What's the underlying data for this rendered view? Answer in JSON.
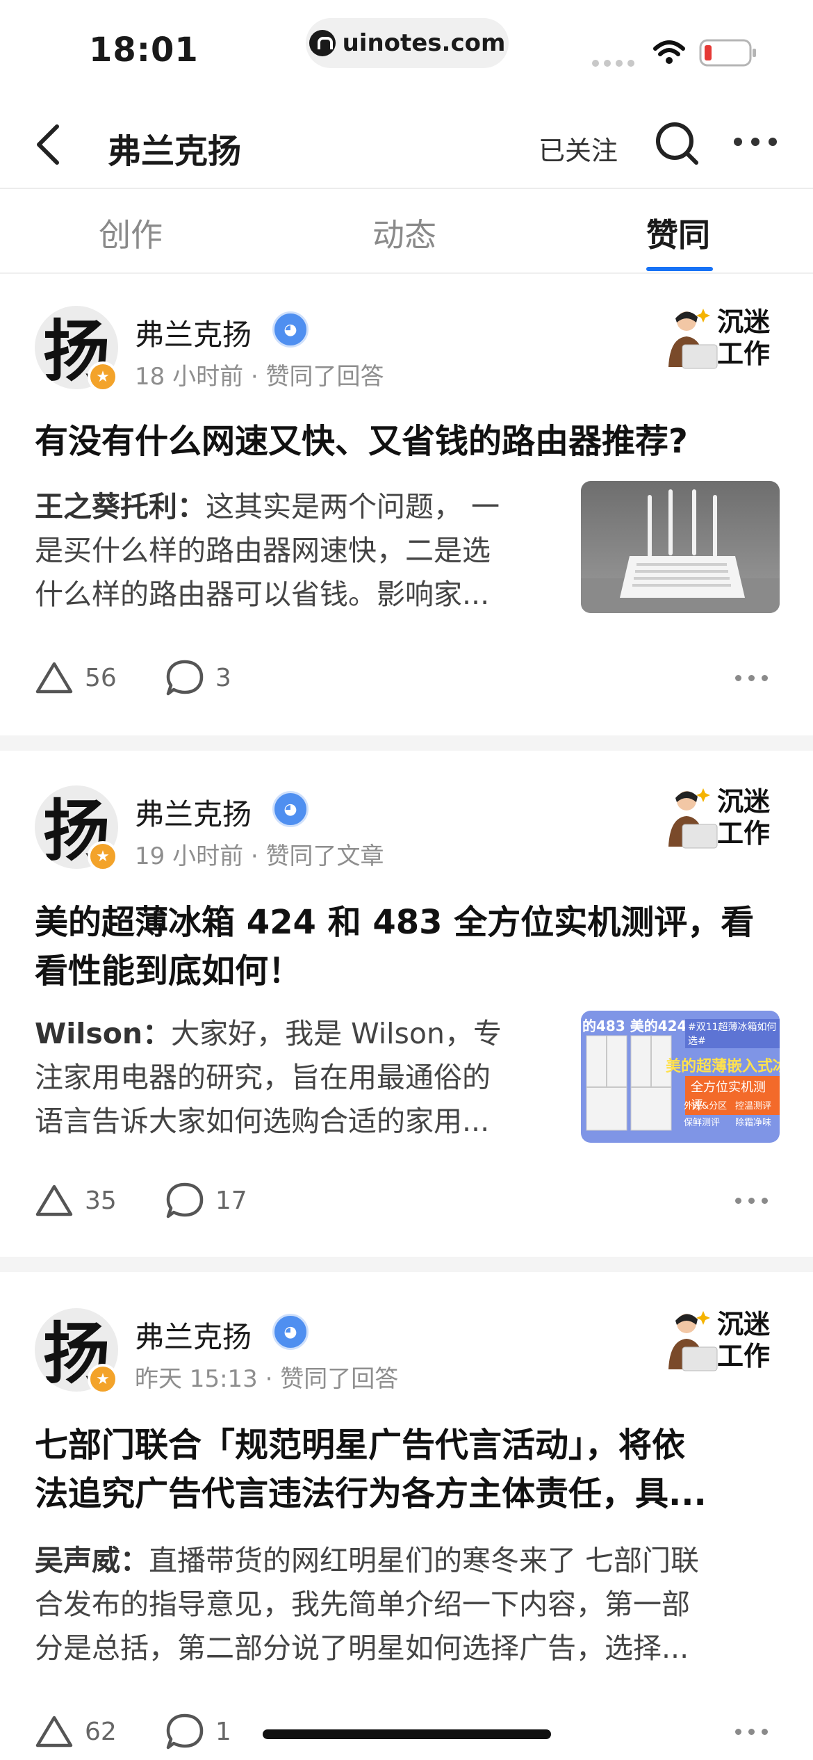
{
  "status_bar": {
    "time": "18:01",
    "url": "uinotes.com"
  },
  "header": {
    "title": "弗兰克扬",
    "follow_label": "已关注"
  },
  "tabs": [
    {
      "label": "创作",
      "active": false
    },
    {
      "label": "动态",
      "active": false
    },
    {
      "label": "赞同",
      "active": true
    }
  ],
  "feed": [
    {
      "avatar_char": "扬",
      "author": "弗兰克扬",
      "time": "18 小时前",
      "action": "赞同了回答",
      "promo_line1": "沉迷",
      "promo_line2": "工作",
      "title": "有没有什么网速又快、又省钱的路由器推荐?",
      "excerpt_author": "王之葵托利：",
      "excerpt_lines": [
        "这其实是两个问题， 一",
        "是买什么样的路由器网速快，二是选",
        "什么样的路由器可以省钱。影响家..."
      ],
      "likes": "56",
      "comments": "3"
    },
    {
      "avatar_char": "扬",
      "author": "弗兰克扬",
      "time": "19 小时前",
      "action": "赞同了文章",
      "promo_line1": "沉迷",
      "promo_line2": "工作",
      "title_lines": [
        "美的超薄冰箱 424 和 483 全方位实机测评，看",
        "看性能到底如何！"
      ],
      "excerpt_author": "Wilson：",
      "excerpt_lines": [
        "大家好，我是 Wilson，专",
        "注家用电器的研究，旨在用最通俗的",
        "语言告诉大家如何选购合适的家用..."
      ],
      "thumb_text": [
        "的483 美的424",
        "#双11超薄冰箱如何选#",
        "美的超薄嵌入式冰",
        "全方位实机测评",
        "外观&分区",
        "控温测评",
        "保鲜测评",
        "除霜净味"
      ],
      "likes": "35",
      "comments": "17"
    },
    {
      "avatar_char": "扬",
      "author": "弗兰克扬",
      "time": "昨天 15:13",
      "action": "赞同了回答",
      "promo_line1": "沉迷",
      "promo_line2": "工作",
      "title_lines": [
        "七部门联合「规范明星广告代言活动」，将依",
        "法追究广告代言违法行为各方主体责任，具..."
      ],
      "excerpt_author": "吴声威：",
      "excerpt_lines": [
        "直播带货的网红明星们的寒冬来了 七部门联",
        "合发布的指导意见，我先简单介绍一下内容，第一部",
        "分是总括，第二部分说了明星如何选择广告，选择..."
      ],
      "likes": "62",
      "comments": "1"
    }
  ],
  "colors": {
    "accent": "#1772f6",
    "badge": "#f3a32a",
    "separator": "#f4f4f4"
  }
}
